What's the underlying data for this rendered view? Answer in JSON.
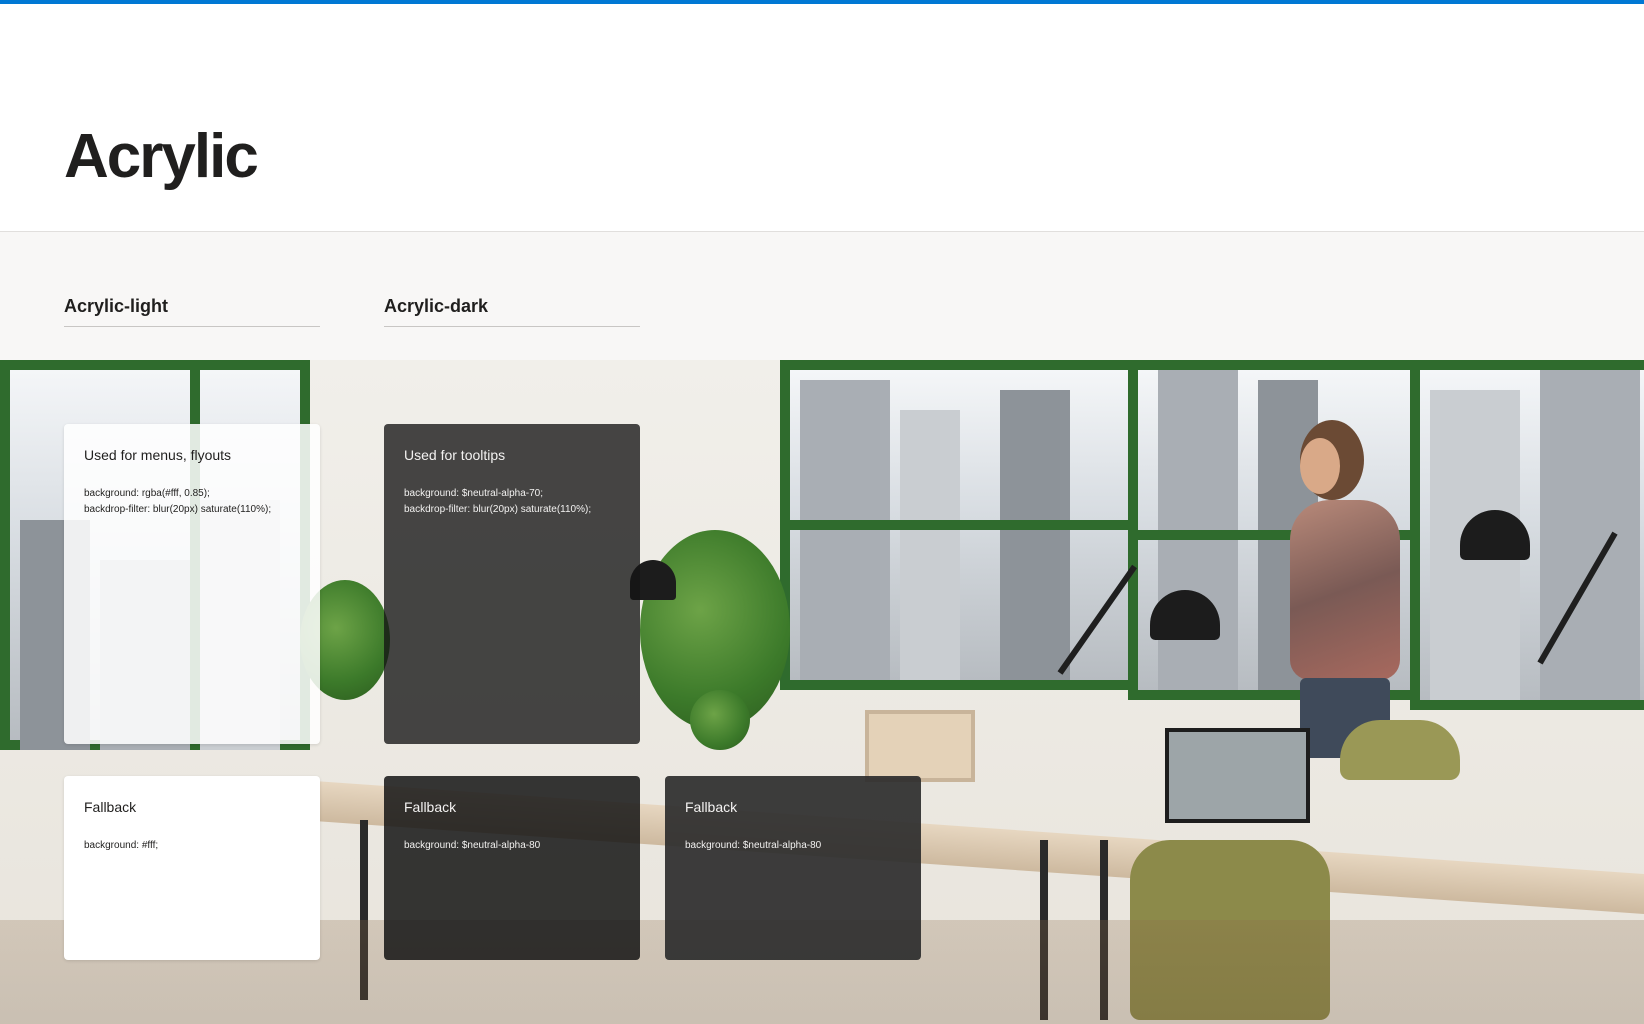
{
  "page": {
    "title": "Acrylic",
    "accent_color": "#0078d4"
  },
  "sections": {
    "light_heading": "Acrylic-light",
    "dark_heading": "Acrylic-dark"
  },
  "cards": {
    "acrylic_light": {
      "title": "Used for menus, flyouts",
      "code": "background: rgba(#fff, 0.85);\nbackdrop-filter: blur(20px) saturate(110%);"
    },
    "acrylic_dark": {
      "title": "Used for tooltips",
      "code": "background: $neutral-alpha-70;\nbackdrop-filter: blur(20px) saturate(110%);"
    },
    "fallback_light": {
      "title": "Fallback",
      "code": "background: #fff;"
    },
    "fallback_dark": {
      "title": "Fallback",
      "code": "background: $neutral-alpha-80"
    },
    "fallback_dark_2": {
      "title": "Fallback",
      "code": "background: $neutral-alpha-80"
    }
  }
}
